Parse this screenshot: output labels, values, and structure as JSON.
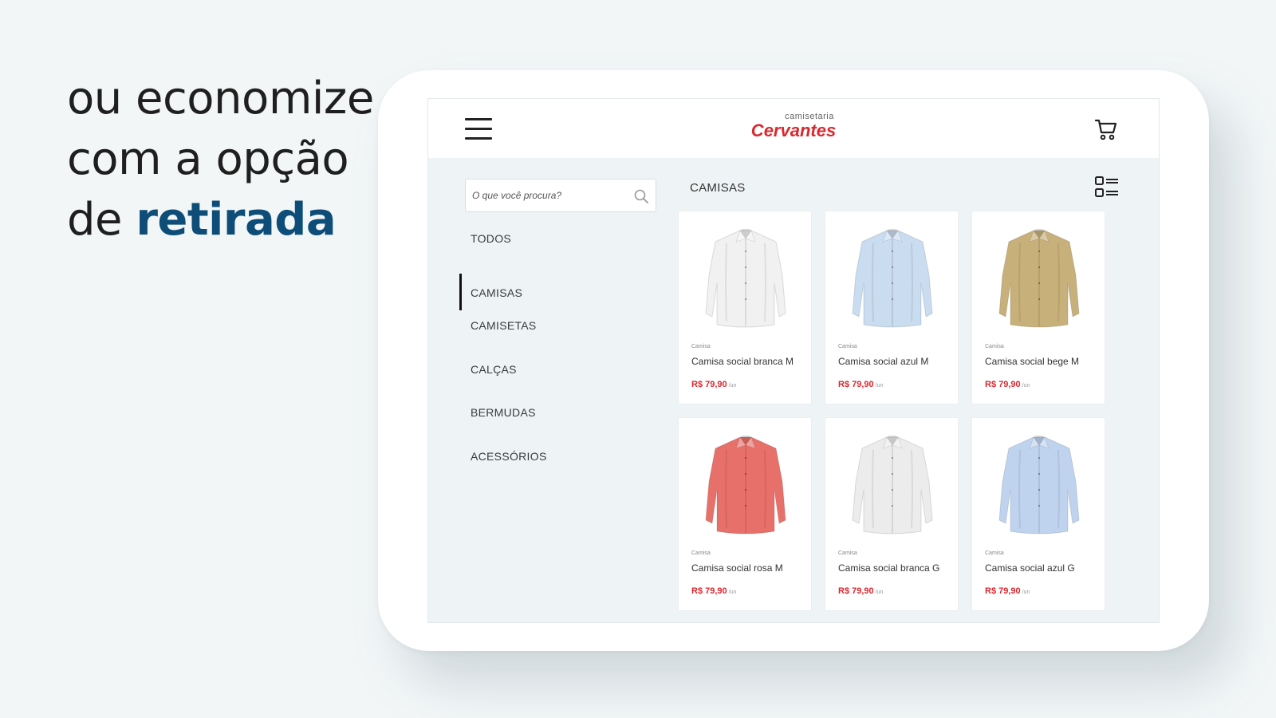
{
  "headline": {
    "line1": "ou economize",
    "line2": "com a opção",
    "line3_prefix": "de ",
    "line3_accent": "retirada"
  },
  "app": {
    "logo_small": "camisetaria",
    "logo_brand": "Cervantes",
    "search_placeholder": "O que você procura?",
    "section_title": "CAMISAS",
    "categories": [
      "TODOS",
      "CAMISAS",
      "CAMISETAS",
      "CALÇAS",
      "BERMUDAS",
      "ACESSÓRIOS"
    ],
    "active_category": "CAMISAS",
    "products": [
      {
        "category": "Camisa",
        "name": "Camisa social branca M",
        "price": "R$ 79,90",
        "unit": "/un",
        "color": "#f1f1f1"
      },
      {
        "category": "Camisa",
        "name": "Camisa social azul M",
        "price": "R$ 79,90",
        "unit": "/un",
        "color": "#c9dcf0"
      },
      {
        "category": "Camisa",
        "name": "Camisa social bege M",
        "price": "R$ 79,90",
        "unit": "/un",
        "color": "#c7b07a"
      },
      {
        "category": "Camisa",
        "name": "Camisa social rosa M",
        "price": "R$ 79,90",
        "unit": "/un",
        "color": "#e8706a"
      },
      {
        "category": "Camisa",
        "name": "Camisa social branca G",
        "price": "R$ 79,90",
        "unit": "/un",
        "color": "#ececec"
      },
      {
        "category": "Camisa",
        "name": "Camisa social azul G",
        "price": "R$ 79,90",
        "unit": "/un",
        "color": "#bfd3ef"
      }
    ]
  },
  "colors": {
    "background": "#f2f6f7",
    "accent": "#0d4d78",
    "brand": "#d9282f"
  }
}
